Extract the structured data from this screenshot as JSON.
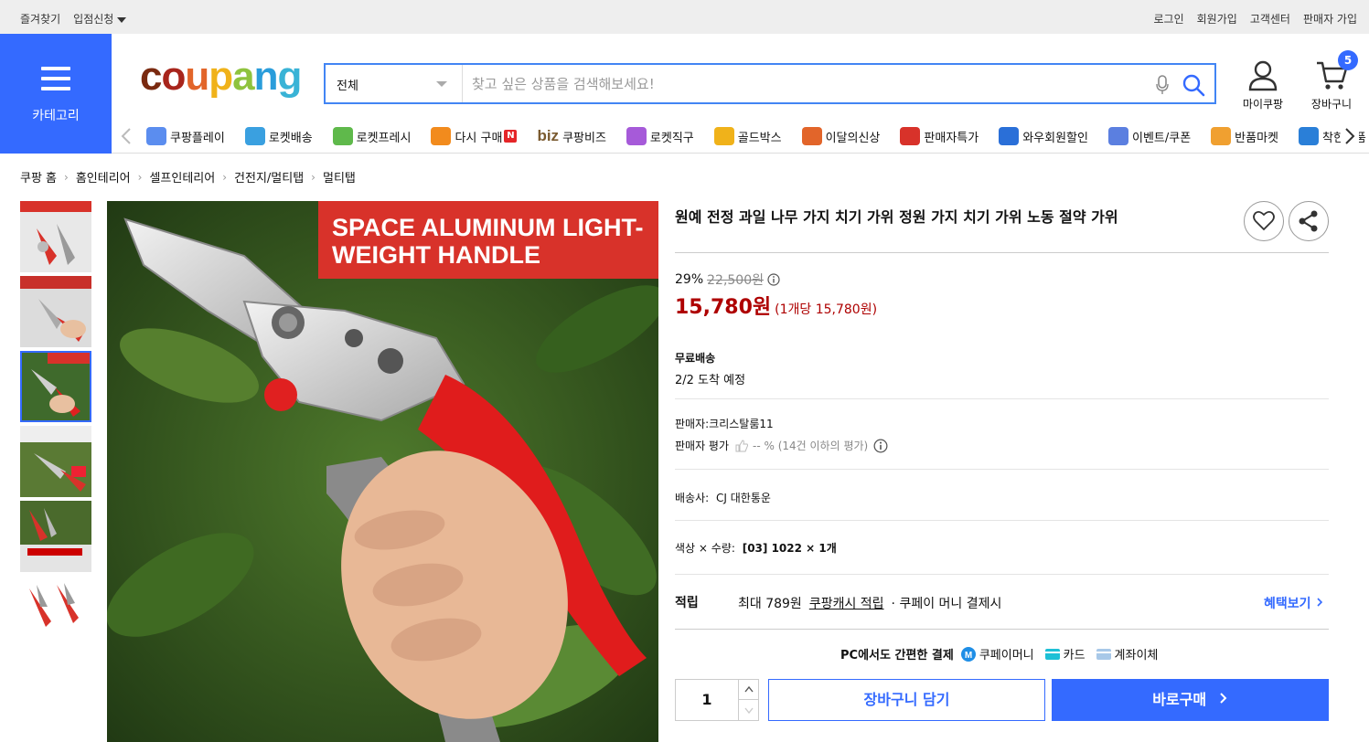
{
  "topbar": {
    "left": [
      "즐겨찾기",
      "입점신청"
    ],
    "right": [
      "로그인",
      "회원가입",
      "고객센터",
      "판매자 가입"
    ]
  },
  "category": {
    "label": "카테고리"
  },
  "logo": {
    "text": [
      "c",
      "o",
      "u",
      "p",
      "a",
      "n",
      "g"
    ]
  },
  "search": {
    "category": "전체",
    "placeholder": "찾고 싶은 상품을 검색해보세요!"
  },
  "header": {
    "mycoupang": "마이쿠팡",
    "cart": "장바구니",
    "cart_count": "5"
  },
  "nav": {
    "items": [
      {
        "label": "쿠팡플레이",
        "color": "#5b8def"
      },
      {
        "label": "로켓배송",
        "color": "#3aa0e0"
      },
      {
        "label": "로켓프레시",
        "color": "#5fb94b"
      },
      {
        "label": "다시 구매",
        "color": "#f28b1d",
        "badge": "N"
      },
      {
        "label": "쿠팡비즈",
        "prefix": "biz",
        "color": "#7a5a2f"
      },
      {
        "label": "로켓직구",
        "color": "#a65ad9"
      },
      {
        "label": "골드박스",
        "color": "#f0b21a"
      },
      {
        "label": "이달의신상",
        "color": "#e2652a"
      },
      {
        "label": "판매자특가",
        "color": "#d8322a"
      },
      {
        "label": "와우회원할인",
        "color": "#2a6fd8"
      },
      {
        "label": "이벤트/쿠폰",
        "color": "#5b7fe0"
      },
      {
        "label": "반품마켓",
        "color": "#f0a030"
      },
      {
        "label": "착한상품",
        "color": "#2a7fd8"
      }
    ]
  },
  "breadcrumb": [
    "쿠팡 홈",
    "홈인테리어",
    "셀프인테리어",
    "건전지/멀티탭",
    "멀티탭"
  ],
  "product": {
    "title": "원예 전정 과일 나무 가지 치기 가위 정원 가지 치기 가위 노동 절약 가위",
    "image_text": [
      "SPACE ALUMINUM LIGHT-",
      "WEIGHT HANDLE"
    ],
    "discount_rate": "29%",
    "original_price": "22,500원",
    "price": "15,780원",
    "unit_price": "(1개당 15,780원)",
    "shipping_title": "무료배송",
    "arrival": "2/2 도착 예정",
    "seller_label": "판매자:",
    "seller": "크리스탈룸11",
    "seller_rating_label": "판매자 평가",
    "seller_rating": "-- % (14건 이하의 평가)",
    "carrier_label": "배송사:",
    "carrier": "CJ 대한통운",
    "option_label": "색상 × 수량:",
    "option": "[03] 1022 × 1개",
    "reward_label": "적립",
    "reward_text": "최대 789원",
    "reward_link": "쿠팡캐시 적립",
    "reward_suffix": "· 쿠페이 머니 결제시",
    "benefit_link": "혜택보기",
    "pay_title": "PC에서도 간편한 결제",
    "pay_methods": [
      "쿠페이머니",
      "카드",
      "계좌이체"
    ],
    "quantity": "1",
    "add_to_cart": "장바구니 담기",
    "buy_now": "바로구매"
  }
}
